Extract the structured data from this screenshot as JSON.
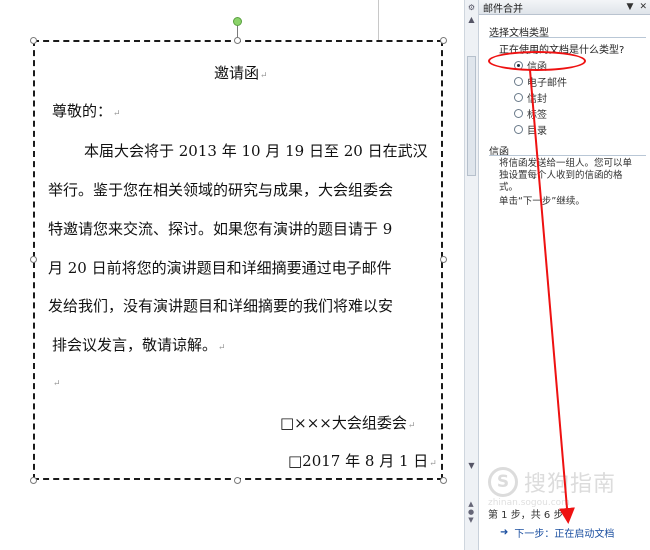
{
  "document": {
    "title": "邀请函",
    "salutation": "尊敬的：",
    "body_lines": [
      "本届大会将于 2013 年 10 月 19 日至 20 日在武汉",
      "举行。鉴于您在相关领域的研究与成果，大会组委会",
      "特邀请您来交流、探讨。如果您有演讲的题目请于 9",
      "月  20  日前将您的演讲题目和详细摘要通过电子邮件",
      "发给我们，没有演讲题目和详细摘要的我们将难以安",
      "排会议发言，敬请谅解。"
    ],
    "signature": "□×××大会组委会",
    "date": "□2017 年 8 月 1 日",
    "para_mark": "↵"
  },
  "pane": {
    "title": "邮件合并",
    "section1": "选择文档类型",
    "question": "正在使用的文档是什么类型?",
    "options": [
      {
        "label": "信函",
        "selected": true
      },
      {
        "label": "电子邮件",
        "selected": false
      },
      {
        "label": "信封",
        "selected": false
      },
      {
        "label": "标签",
        "selected": false
      },
      {
        "label": "目录",
        "selected": false
      }
    ],
    "section2": "信函",
    "desc1": "将信函发送给一组人。您可以单独设置每个人收到的信函的格式。",
    "desc2": "单击“下一步”继续。",
    "step": "第 1 步，共 6 步",
    "next": "下一步：正在启动文档"
  },
  "watermark": {
    "logo": "S",
    "text": "搜狗指南",
    "url": "zhinan.sogou.com"
  },
  "colors": {
    "annotation": "#ee1111",
    "link": "#1b4fa0",
    "rotate_handle": "#8bd36a"
  }
}
